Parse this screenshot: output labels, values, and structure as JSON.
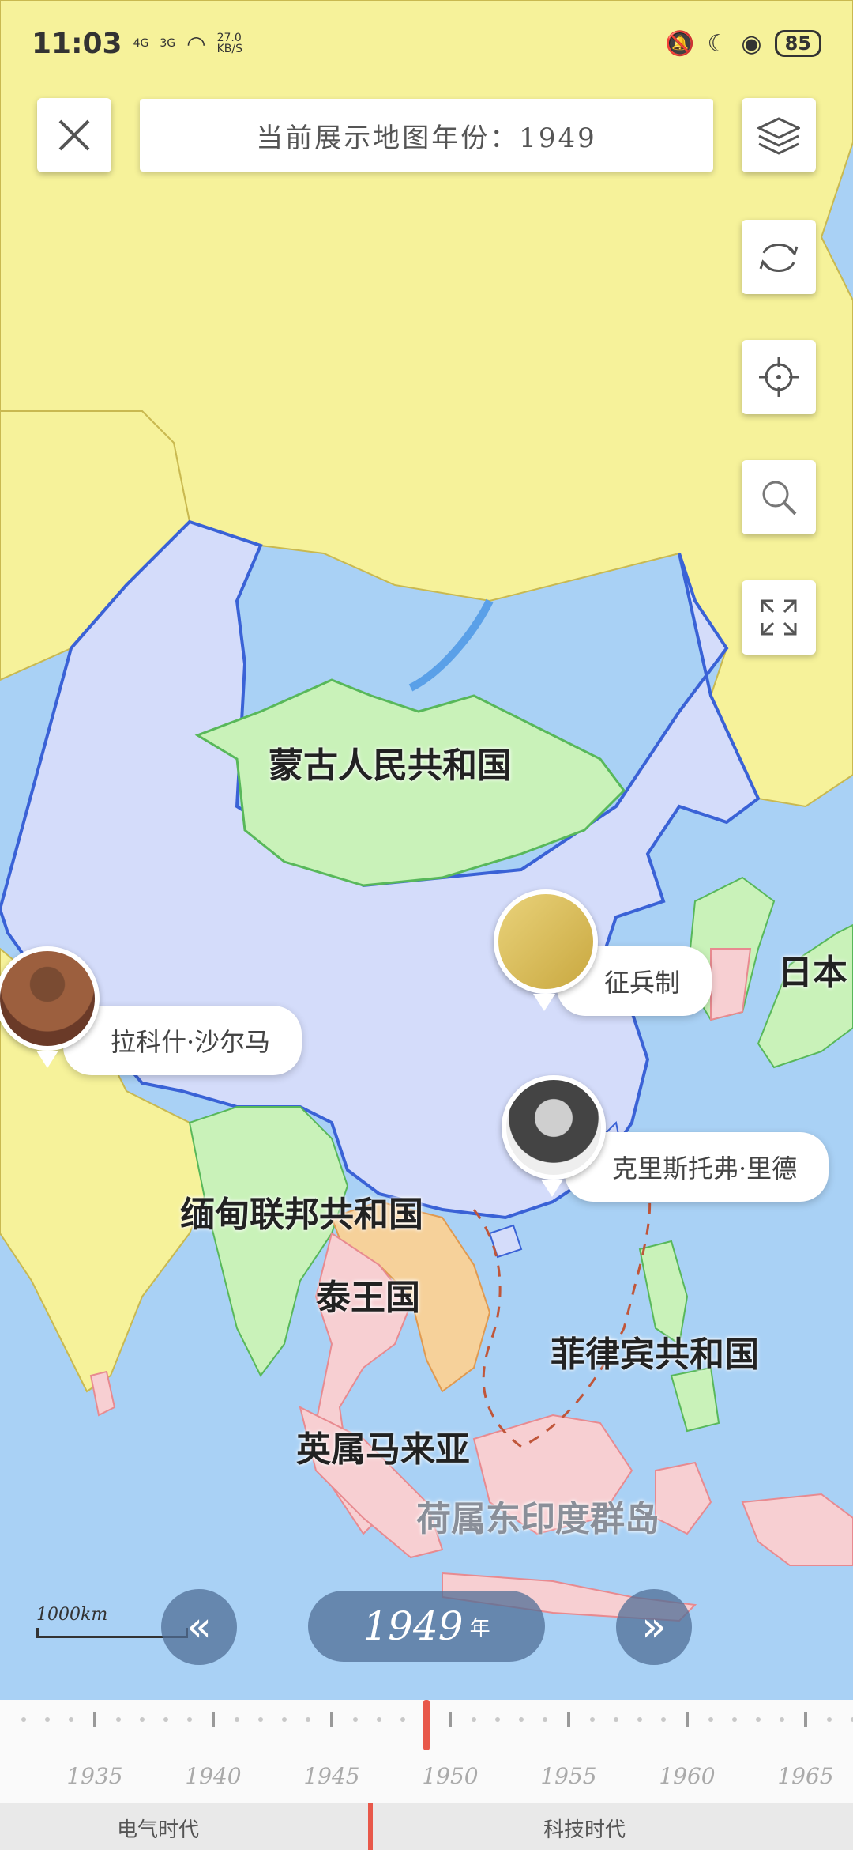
{
  "status_bar": {
    "time": "11:03",
    "net_4g": "4G",
    "net_3g": "3G",
    "speed_value": "27.0",
    "speed_unit": "KB/S",
    "battery": "85"
  },
  "header": {
    "year_banner": "当前展示地图年份：1949"
  },
  "map_labels": {
    "mongolia": "蒙古人民共和国",
    "japan": "日本",
    "burma": "缅甸联邦共和国",
    "thailand": "泰王国",
    "philippines": "菲律宾共和国",
    "malaya": "英属马来亚",
    "dutch_east_indies": "荷属东印度群岛"
  },
  "pins": {
    "conscription": "征兵制",
    "rajkishor": "拉科什·沙尔马",
    "christopher": "克里斯托弗·里德"
  },
  "scale": {
    "label": "1000km"
  },
  "year_nav": {
    "prev": "«",
    "next": "»",
    "year": "1949",
    "unit": "年"
  },
  "timeline": {
    "current_year": 1949,
    "labels": [
      "1935",
      "1940",
      "1945",
      "1950",
      "1955",
      "1960",
      "1965"
    ],
    "eras": [
      "电气时代",
      "科技时代"
    ]
  },
  "colors": {
    "ocean": "#a9d1f5",
    "land_default": "#f6f29a",
    "china": "#d4dcfa",
    "mongolia": "#c9f2b9",
    "colonial_pink": "#f7cfd2",
    "accent_red": "#e8584a"
  }
}
